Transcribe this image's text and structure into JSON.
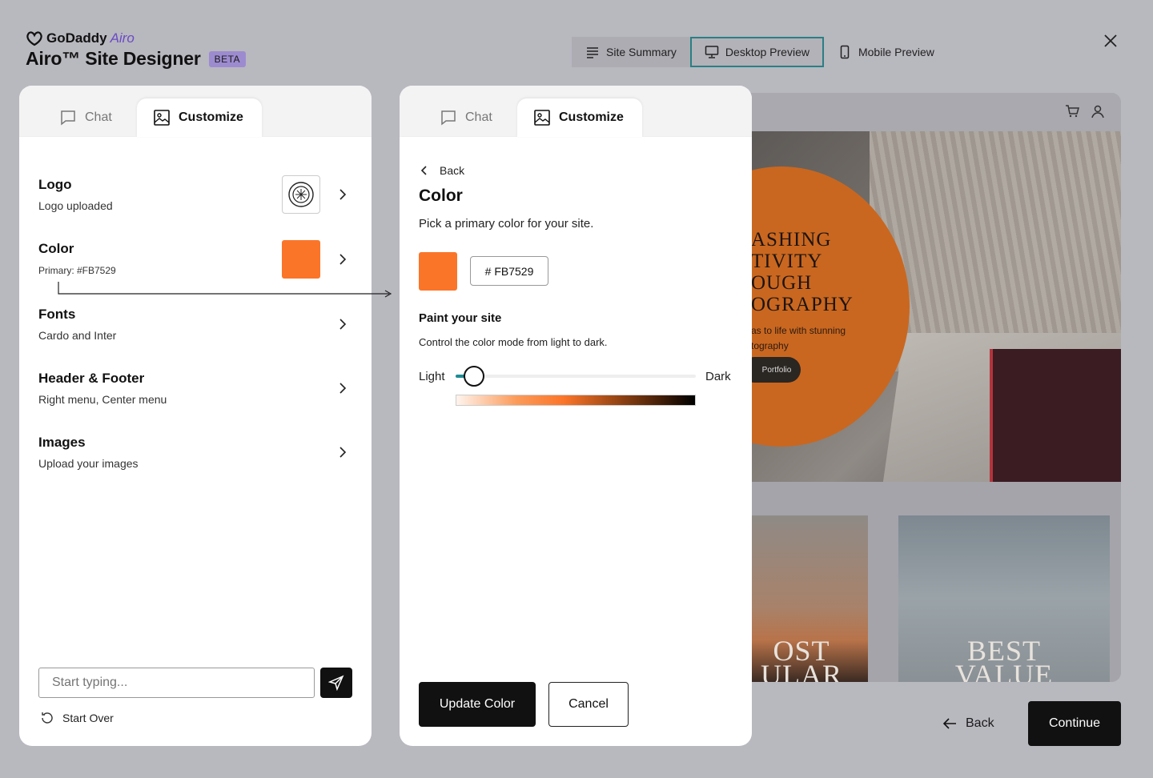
{
  "brand": {
    "name": "GoDaddy",
    "product": "Airo"
  },
  "app": {
    "title": "Airo™ Site Designer",
    "badge": "BETA"
  },
  "top_tabs": [
    {
      "label": "Site Summary",
      "icon": "list-icon"
    },
    {
      "label": "Desktop Preview",
      "icon": "monitor-icon",
      "active": true
    },
    {
      "label": "Mobile Preview",
      "icon": "phone-icon"
    }
  ],
  "left_panel": {
    "tabs": [
      {
        "label": "Chat",
        "icon": "chat-icon"
      },
      {
        "label": "Customize",
        "icon": "image-icon",
        "active": true
      }
    ],
    "rows": [
      {
        "title": "Logo",
        "sub": "Logo uploaded"
      },
      {
        "title": "Color",
        "sub": "Primary: #FB7529"
      },
      {
        "title": "Fonts",
        "sub": "Cardo and Inter"
      },
      {
        "title": "Header & Footer",
        "sub": "Right menu, Center menu"
      },
      {
        "title": "Images",
        "sub": "Upload your images"
      }
    ],
    "chat_input": {
      "placeholder": "Start typing..."
    },
    "start_over": "Start Over"
  },
  "right_panel": {
    "tabs": [
      {
        "label": "Chat",
        "icon": "chat-icon"
      },
      {
        "label": "Customize",
        "icon": "image-icon",
        "active": true
      }
    ],
    "back": "Back",
    "title": "Color",
    "subtitle": "Pick a primary color for your site.",
    "hex_value": "# FB7529",
    "primary_color": "#FB7529",
    "paint_title": "Paint your site",
    "paint_desc": "Control the color mode from light to dark.",
    "slider": {
      "min_label": "Light",
      "max_label": "Dark",
      "value": 0.08
    },
    "update_button": "Update Color",
    "cancel_button": "Cancel"
  },
  "preview": {
    "headline": [
      "ASHING",
      "TIVITY",
      "OUGH",
      "OGRAPHY"
    ],
    "subtext": [
      "as to life with stunning",
      "tography"
    ],
    "pill": "Portfolio",
    "card1_text": [
      "OST",
      "ULAR"
    ],
    "card2_text": [
      "BEST",
      "VALUE"
    ]
  },
  "footer_nav": {
    "back": "Back",
    "continue": "Continue"
  },
  "colors": {
    "accent_teal": "#1e8c93",
    "primary": "#FB7529",
    "beta_bg": "#9d8bd0"
  }
}
